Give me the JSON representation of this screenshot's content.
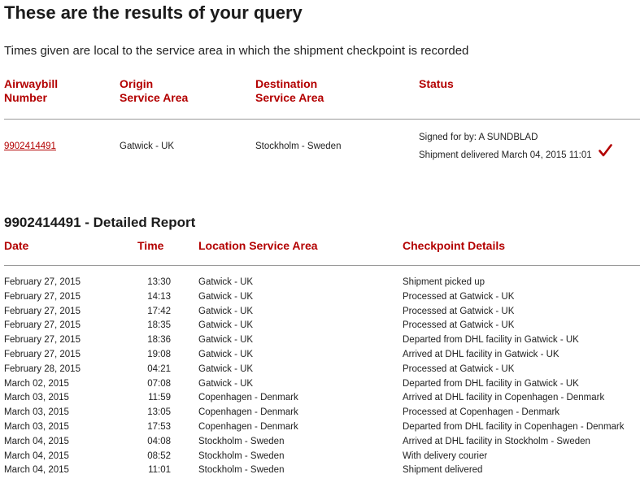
{
  "header": {
    "title": "These are the results of your query",
    "subtitle": "Times given are local to the service area in which the shipment checkpoint is recorded"
  },
  "summary": {
    "columns": {
      "awb_line1": "Airwaybill",
      "awb_line2": "Number",
      "origin_line1": "Origin",
      "origin_line2": "Service Area",
      "destination_line1": "Destination",
      "destination_line2": "Service Area",
      "status": "Status"
    },
    "row": {
      "awb": "9902414491",
      "origin": "Gatwick - UK",
      "destination": "Stockholm - Sweden",
      "signed_for": "Signed for by: A SUNDBLAD",
      "delivered": "Shipment delivered March 04, 2015 11:01"
    },
    "status_icon": "checkmark-icon",
    "accent_color": "#b30000"
  },
  "report": {
    "title": "9902414491 - Detailed Report",
    "columns": {
      "date": "Date",
      "time": "Time",
      "location": "Location Service Area",
      "details": "Checkpoint Details"
    },
    "rows": [
      {
        "date": "February 27, 2015",
        "time": "13:30",
        "location": "Gatwick - UK",
        "details": "Shipment picked up"
      },
      {
        "date": "February 27, 2015",
        "time": "14:13",
        "location": "Gatwick - UK",
        "details": "Processed at Gatwick - UK"
      },
      {
        "date": "February 27, 2015",
        "time": "17:42",
        "location": "Gatwick - UK",
        "details": "Processed at Gatwick - UK"
      },
      {
        "date": "February 27, 2015",
        "time": "18:35",
        "location": "Gatwick - UK",
        "details": "Processed at Gatwick - UK"
      },
      {
        "date": "February 27, 2015",
        "time": "18:36",
        "location": "Gatwick - UK",
        "details": "Departed from DHL facility in Gatwick - UK"
      },
      {
        "date": "February 27, 2015",
        "time": "19:08",
        "location": "Gatwick - UK",
        "details": "Arrived at DHL facility in Gatwick - UK"
      },
      {
        "date": "February 28, 2015",
        "time": "04:21",
        "location": "Gatwick - UK",
        "details": "Processed at Gatwick - UK"
      },
      {
        "date": "March 02, 2015",
        "time": "07:08",
        "location": "Gatwick - UK",
        "details": "Departed from DHL facility in Gatwick - UK"
      },
      {
        "date": "March 03, 2015",
        "time": "11:59",
        "location": "Copenhagen - Denmark",
        "details": "Arrived at DHL facility in Copenhagen - Denmark"
      },
      {
        "date": "March 03, 2015",
        "time": "13:05",
        "location": "Copenhagen - Denmark",
        "details": "Processed at Copenhagen - Denmark"
      },
      {
        "date": "March 03, 2015",
        "time": "17:53",
        "location": "Copenhagen - Denmark",
        "details": "Departed from DHL facility in Copenhagen - Denmark"
      },
      {
        "date": "March 04, 2015",
        "time": "04:08",
        "location": "Stockholm - Sweden",
        "details": "Arrived at DHL facility in Stockholm - Sweden"
      },
      {
        "date": "March 04, 2015",
        "time": "08:52",
        "location": "Stockholm - Sweden",
        "details": "With delivery courier"
      },
      {
        "date": "March 04, 2015",
        "time": "11:01",
        "location": "Stockholm - Sweden",
        "details": "Shipment delivered"
      }
    ]
  }
}
